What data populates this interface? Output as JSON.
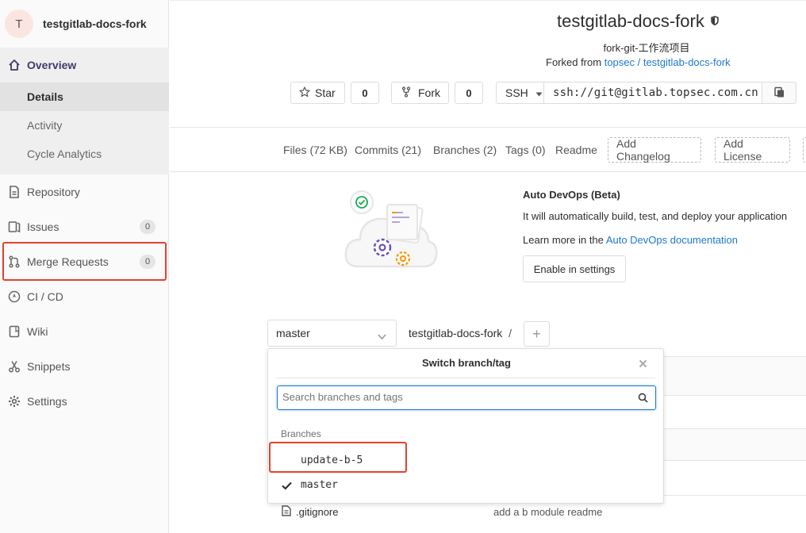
{
  "project": {
    "avatar_letter": "T",
    "name": "testgitlab-docs-fork",
    "title": "testgitlab-docs-fork",
    "description": "fork-git-工作流项目",
    "forked_from_label": "Forked from",
    "forked_from_link": "topsec / testgitlab-docs-fork"
  },
  "sidebar": {
    "overview": "Overview",
    "sub": {
      "details": "Details",
      "activity": "Activity",
      "cycle": "Cycle Analytics"
    },
    "repository": "Repository",
    "issues": "Issues",
    "issues_count": "0",
    "merge_requests": "Merge Requests",
    "merge_requests_count": "0",
    "cicd": "CI / CD",
    "wiki": "Wiki",
    "snippets": "Snippets",
    "settings": "Settings"
  },
  "actions": {
    "star": "Star",
    "star_count": "0",
    "fork": "Fork",
    "fork_count": "0",
    "protocol": "SSH",
    "clone_url": "ssh://git@gitlab.topsec.com.cn"
  },
  "stats": {
    "files": "Files (72 KB)",
    "commits": "Commits (21)",
    "branches": "Branches (2)",
    "tags": "Tags (0)",
    "readme": "Readme",
    "add_changelog": "Add Changelog",
    "add_license": "Add License"
  },
  "devops": {
    "title": "Auto DevOps (Beta)",
    "desc": "It will automatically build, test, and deploy your application",
    "learn_prefix": "Learn more in the",
    "learn_link": "Auto DevOps documentation",
    "enable": "Enable in settings"
  },
  "repo_bar": {
    "branch": "master",
    "path": "testgitlab-docs-fork",
    "sep": "/",
    "add": "+"
  },
  "dropdown": {
    "title": "Switch branch/tag",
    "search_placeholder": "Search branches and tags",
    "section": "Branches",
    "items": [
      "update-b-5",
      "master"
    ]
  },
  "file_row": {
    "name": ".gitignore",
    "message": "add a b module readme"
  },
  "colors": {
    "accent": "#1f78d1",
    "highlight": "#e0432f",
    "devops_green": "#1aaa55",
    "devops_purple": "#6b4fbb",
    "devops_orange": "#fc9403"
  }
}
